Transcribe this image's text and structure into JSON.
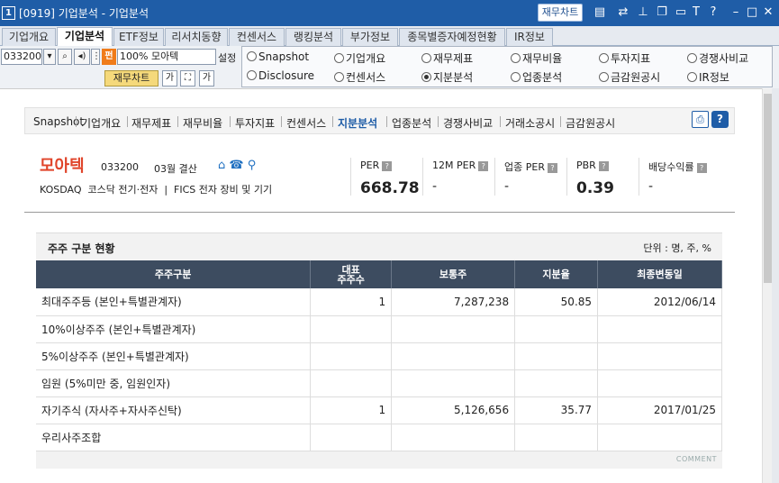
{
  "window": {
    "number": "1",
    "title": "[0919] 기업분석 - 기업분석",
    "top_button": "재무차트"
  },
  "tabs": [
    {
      "label": "기업개요",
      "active": false
    },
    {
      "label": "기업분석",
      "active": true
    },
    {
      "label": "ETF정보",
      "active": false
    },
    {
      "label": "리서치동향",
      "active": false
    },
    {
      "label": "컨센서스",
      "active": false
    },
    {
      "label": "랭킹분석",
      "active": false
    },
    {
      "label": "부가정보",
      "active": false
    },
    {
      "label": "종목별증자예정현황",
      "active": false
    },
    {
      "label": "IR정보",
      "active": false
    }
  ],
  "toolbar": {
    "code": "033200",
    "pe_icon": "펀",
    "stock_name": "100% 모아텍",
    "settings_label": "설정",
    "chart_button": "재무차트",
    "icon_btn1": "가",
    "icon_btn2": "가"
  },
  "radio_options": [
    {
      "label": "Snapshot",
      "checked": false
    },
    {
      "label": "기업개요",
      "checked": false
    },
    {
      "label": "재무제표",
      "checked": false
    },
    {
      "label": "재무비율",
      "checked": false
    },
    {
      "label": "투자지표",
      "checked": false
    },
    {
      "label": "경쟁사비교",
      "checked": false
    },
    {
      "label": "Disclosure",
      "checked": false
    },
    {
      "label": "컨센서스",
      "checked": false
    },
    {
      "label": "지분분석",
      "checked": true
    },
    {
      "label": "업종분석",
      "checked": false
    },
    {
      "label": "금감원공시",
      "checked": false
    },
    {
      "label": "IR정보",
      "checked": false
    }
  ],
  "subnav": {
    "items": [
      "Snapshot",
      "기업개요",
      "재무제표",
      "재무비율",
      "투자지표",
      "컨센서스",
      "지분분석",
      "업종분석",
      "경쟁사비교",
      "거래소공시",
      "금감원공시"
    ],
    "active": "지분분석"
  },
  "company": {
    "name": "모아텍",
    "code": "033200",
    "fiscal": "03월 결산",
    "market_line": "KOSDAQ  코스닥 전기·전자  |  FICS 전자 장비 및 기기"
  },
  "metrics": [
    {
      "label": "PER",
      "value": "668.78"
    },
    {
      "label": "12M PER",
      "value": "-"
    },
    {
      "label": "업종 PER",
      "value": "-"
    },
    {
      "label": "PBR",
      "value": "0.39"
    },
    {
      "label": "배당수익률",
      "value": "-"
    }
  ],
  "section": {
    "title": "주주 구분 현황",
    "unit": "단위 : 명, 주, %"
  },
  "table": {
    "headers": [
      "주주구분",
      "대표\n주주수",
      "보통주",
      "지분율",
      "최종변동일"
    ],
    "rows": [
      [
        "최대주주등 (본인+특별관계자)",
        "1",
        "7,287,238",
        "50.85",
        "2012/06/14"
      ],
      [
        "10%이상주주 (본인+특별관계자)",
        "",
        "",
        "",
        ""
      ],
      [
        "5%이상주주 (본인+특별관계자)",
        "",
        "",
        "",
        ""
      ],
      [
        "임원 (5%미만 중, 임원인자)",
        "",
        "",
        "",
        ""
      ],
      [
        "자기주식 (자사주+자사주신탁)",
        "1",
        "5,126,656",
        "35.77",
        "2017/01/25"
      ],
      [
        "우리사주조합",
        "",
        "",
        "",
        ""
      ]
    ]
  },
  "comment_label": "COMMENT"
}
